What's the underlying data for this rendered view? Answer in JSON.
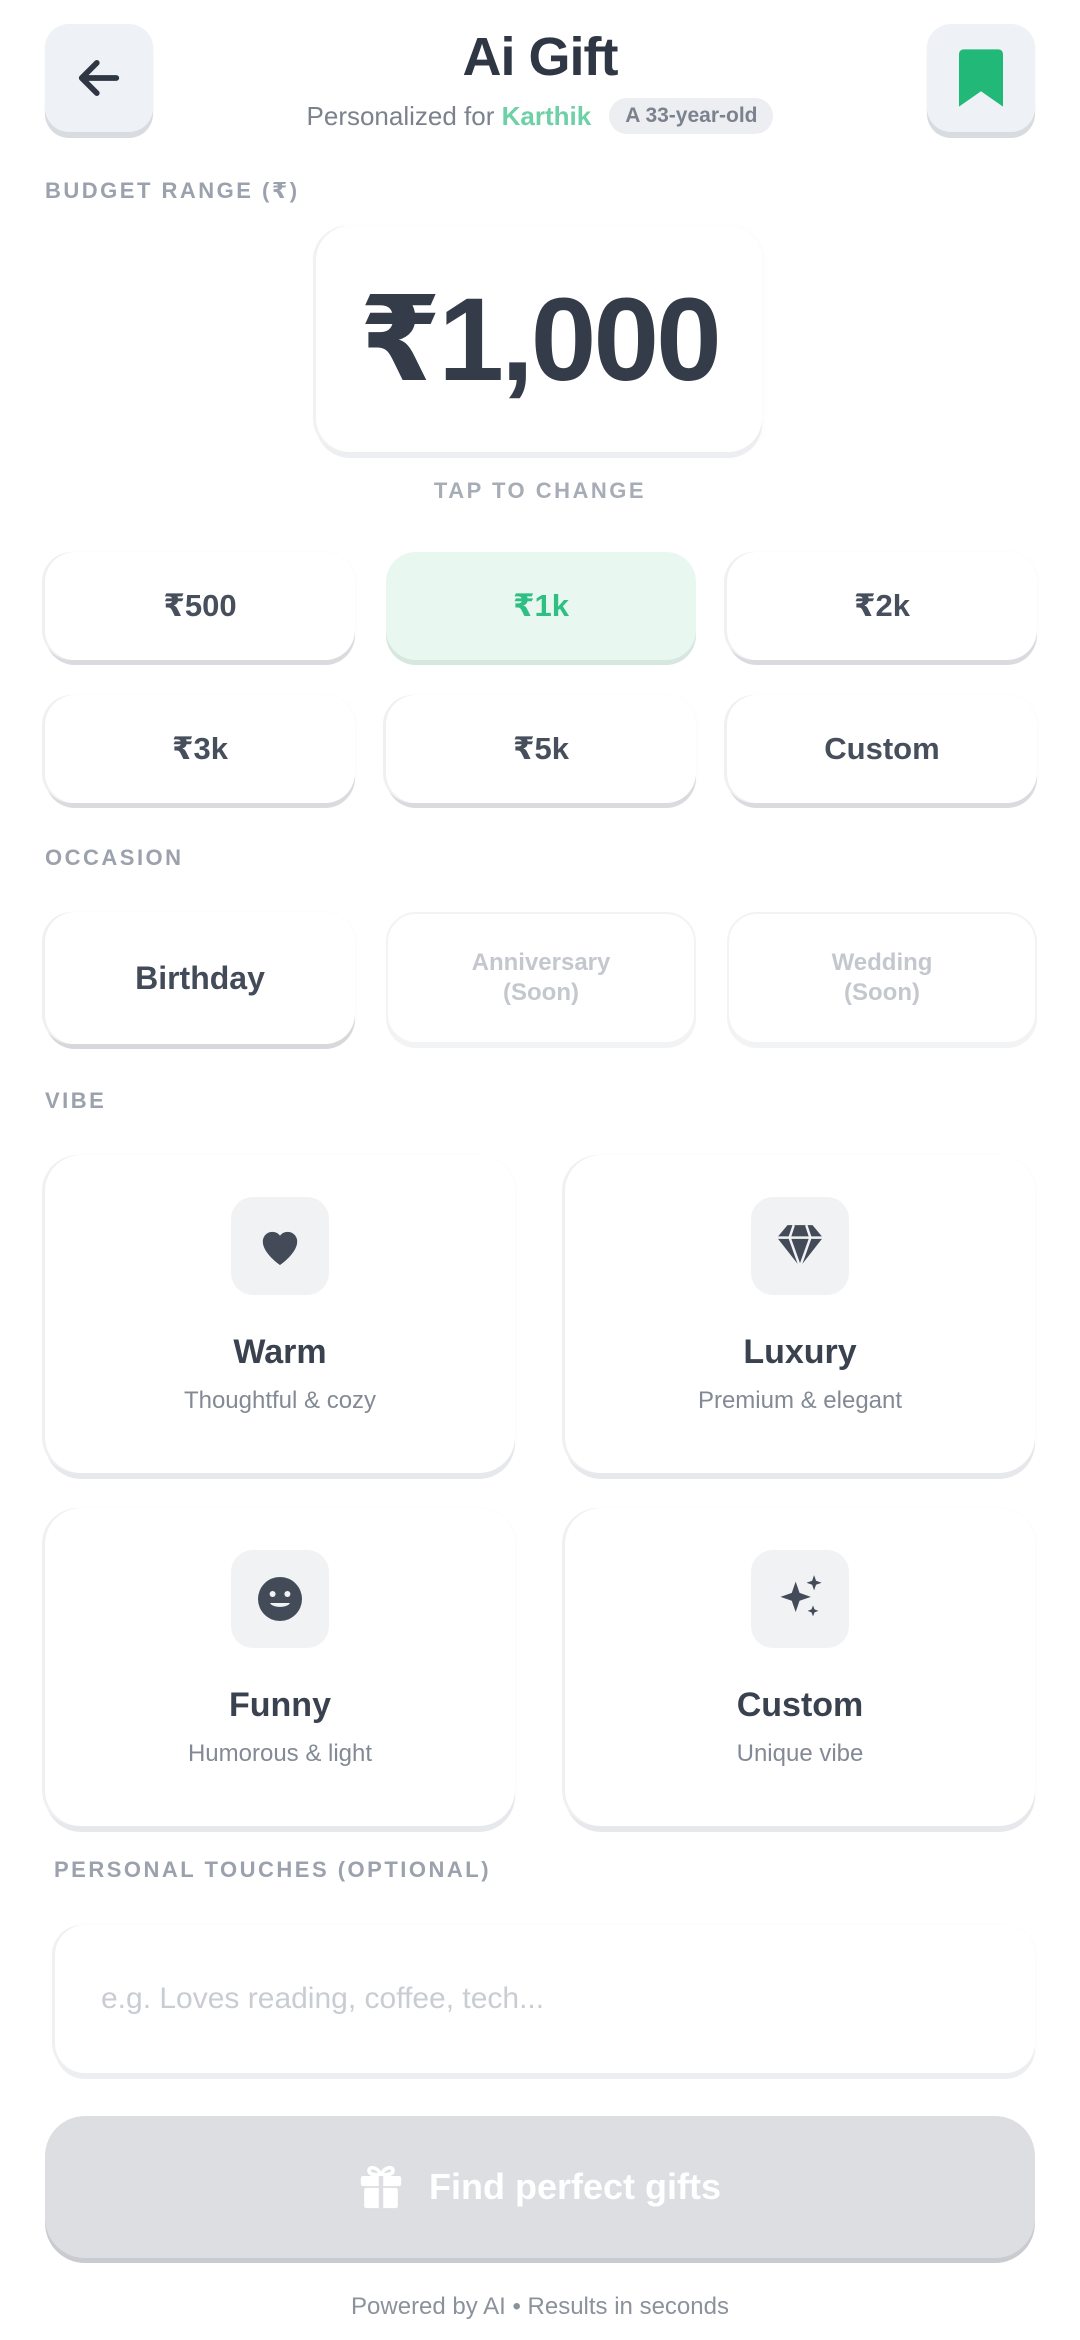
{
  "header": {
    "back_icon": "arrow-left-icon",
    "bookmark_icon": "bookmark-icon",
    "title": "Ai Gift",
    "personalized_prefix": "Personalized for",
    "recipient_name": "Karthik",
    "age_badge": "A 33-year-old"
  },
  "budget": {
    "label": "BUDGET RANGE (₹)",
    "amount": "₹1,000",
    "hint": "TAP TO CHANGE",
    "options": [
      "₹500",
      "₹1k",
      "₹2k",
      "₹3k",
      "₹5k",
      "Custom"
    ],
    "selected": "₹1k"
  },
  "occasion": {
    "label": "OCCASION",
    "options": [
      {
        "line1": "Birthday",
        "line2": "",
        "enabled": true
      },
      {
        "line1": "Anniversary",
        "line2": "(Soon)",
        "enabled": false
      },
      {
        "line1": "Wedding",
        "line2": "(Soon)",
        "enabled": false
      }
    ]
  },
  "vibe": {
    "label": "VIBE",
    "options": [
      {
        "title": "Warm",
        "desc": "Thoughtful & cozy",
        "icon": "heart-icon"
      },
      {
        "title": "Luxury",
        "desc": "Premium & elegant",
        "icon": "diamond-icon"
      },
      {
        "title": "Funny",
        "desc": "Humorous & light",
        "icon": "smile-icon"
      },
      {
        "title": "Custom",
        "desc": "Unique vibe",
        "icon": "sparkles-icon"
      }
    ]
  },
  "touches": {
    "label": "PERSONAL TOUCHES (OPTIONAL)",
    "placeholder": "e.g. Loves reading, coffee, tech...",
    "value": ""
  },
  "cta": {
    "label": "Find perfect gifts",
    "icon": "gift-icon"
  },
  "footer": "Powered by AI • Results in seconds",
  "colors": {
    "accent": "#2fbf82",
    "accent_light": "#e9f7f1",
    "text_dark": "#343b49",
    "muted": "#9ba2ad",
    "disabled_button": "#dcdee2"
  }
}
